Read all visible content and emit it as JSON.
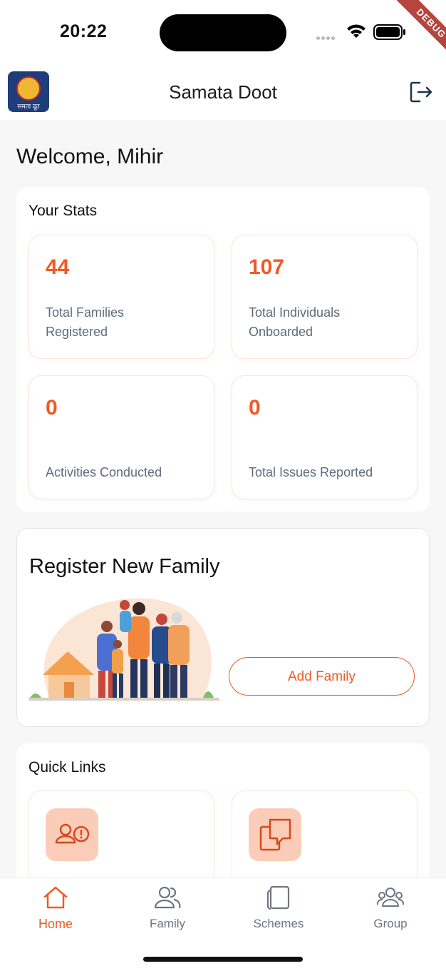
{
  "status_bar": {
    "time": "20:22",
    "debug_label": "DEBUG"
  },
  "app_bar": {
    "title": "Samata Doot",
    "logo_text": "समता दूत"
  },
  "welcome": "Welcome, Mihir",
  "stats": {
    "title": "Your Stats",
    "items": [
      {
        "value": "44",
        "label": "Total Families Registered"
      },
      {
        "value": "107",
        "label": "Total Individuals Onboarded"
      },
      {
        "value": "0",
        "label": "Activities Conducted"
      },
      {
        "value": "0",
        "label": "Total Issues Reported"
      }
    ]
  },
  "register": {
    "title": "Register New Family",
    "button": "Add Family"
  },
  "quick_links": {
    "title": "Quick Links"
  },
  "nav": {
    "items": [
      {
        "label": "Home",
        "icon": "home-icon",
        "active": true
      },
      {
        "label": "Family",
        "icon": "family-icon",
        "active": false
      },
      {
        "label": "Schemes",
        "icon": "schemes-icon",
        "active": false
      },
      {
        "label": "Group",
        "icon": "group-icon",
        "active": false
      }
    ]
  },
  "colors": {
    "accent": "#ef5a23",
    "muted": "#6f7480",
    "icon_bg": "#fbcdb8"
  }
}
